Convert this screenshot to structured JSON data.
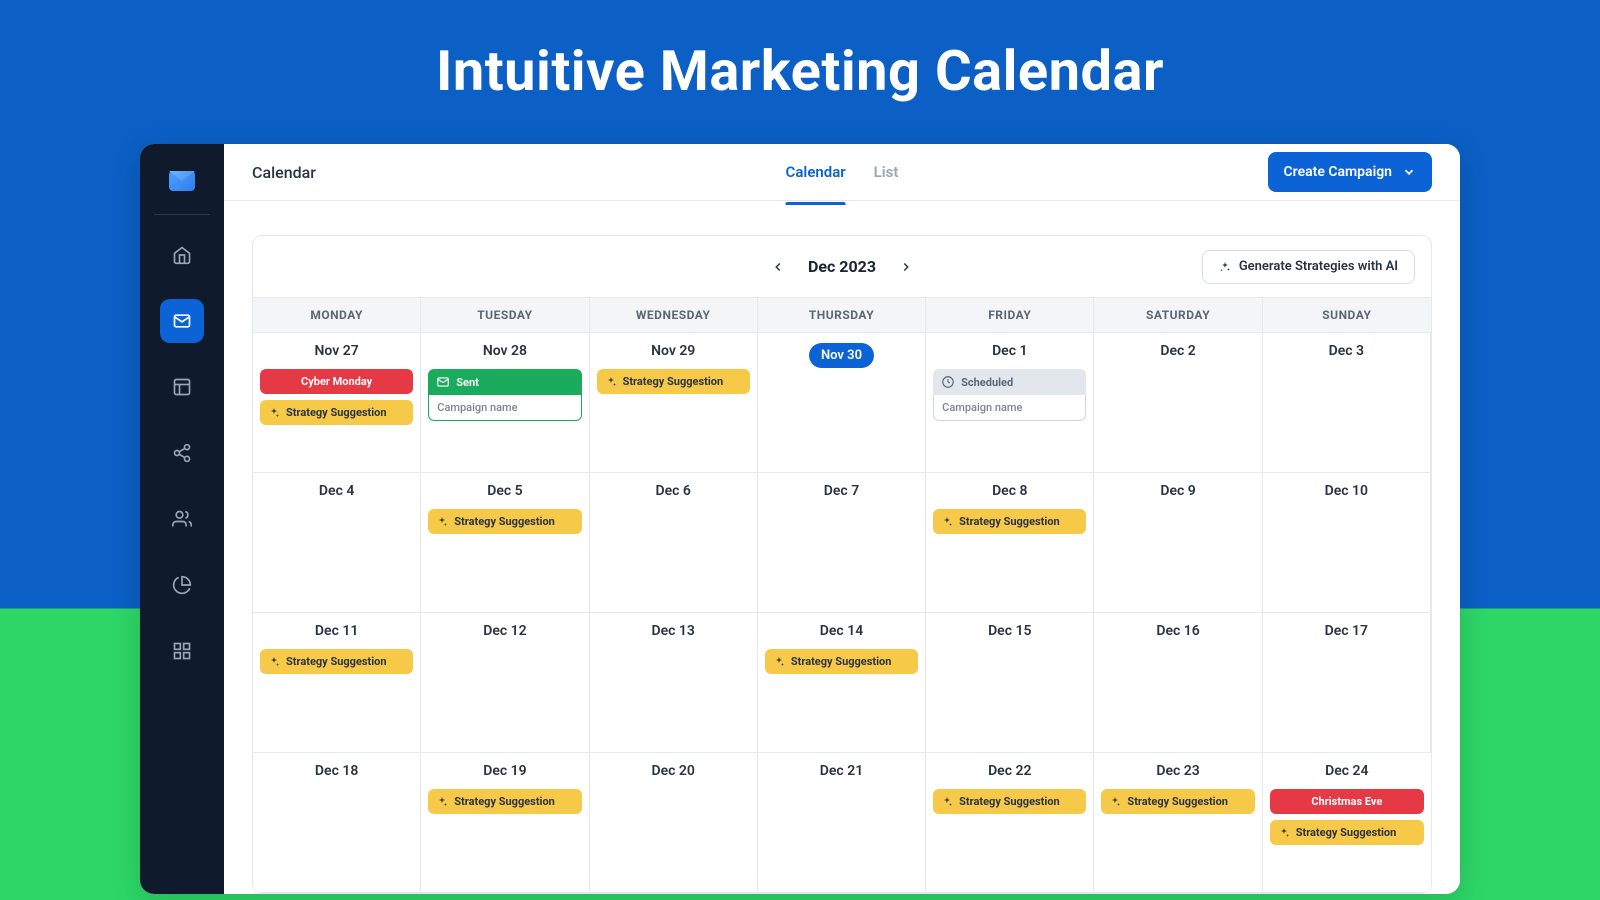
{
  "hero_title": "Intuitive Marketing Calendar",
  "breadcrumb": "Calendar",
  "tabs": {
    "calendar": "Calendar",
    "list": "List"
  },
  "create_btn": "Create Campaign",
  "month_label": "Dec 2023",
  "generate_btn": "Generate Strategies with AI",
  "dow": [
    "MONDAY",
    "TUESDAY",
    "WEDNESDAY",
    "THURSDAY",
    "FRIDAY",
    "SATURDAY",
    "SUNDAY"
  ],
  "labels": {
    "strategy": "Strategy Suggestion",
    "cyber_monday": "Cyber Monday",
    "christmas_eve": "Christmas Eve",
    "sent": "Sent",
    "scheduled": "Scheduled",
    "campaign_name": "Campaign name"
  },
  "weeks": [
    [
      {
        "date": "Nov 27",
        "chips": [
          {
            "t": "red",
            "k": "cyber_monday"
          },
          {
            "t": "yellow",
            "k": "strategy"
          }
        ]
      },
      {
        "date": "Nov 28",
        "chips": [
          {
            "t": "sent"
          }
        ]
      },
      {
        "date": "Nov 29",
        "chips": [
          {
            "t": "yellow",
            "k": "strategy"
          }
        ]
      },
      {
        "date": "Nov 30",
        "today": true,
        "chips": []
      },
      {
        "date": "Dec 1",
        "chips": [
          {
            "t": "scheduled"
          }
        ]
      },
      {
        "date": "Dec 2",
        "chips": []
      },
      {
        "date": "Dec 3",
        "chips": []
      }
    ],
    [
      {
        "date": "Dec 4",
        "chips": []
      },
      {
        "date": "Dec 5",
        "chips": [
          {
            "t": "yellow",
            "k": "strategy"
          }
        ]
      },
      {
        "date": "Dec 6",
        "chips": []
      },
      {
        "date": "Dec 7",
        "chips": []
      },
      {
        "date": "Dec 8",
        "chips": [
          {
            "t": "yellow",
            "k": "strategy"
          }
        ]
      },
      {
        "date": "Dec 9",
        "chips": []
      },
      {
        "date": "Dec 10",
        "chips": []
      }
    ],
    [
      {
        "date": "Dec 11",
        "chips": [
          {
            "t": "yellow",
            "k": "strategy"
          }
        ]
      },
      {
        "date": "Dec 12",
        "chips": []
      },
      {
        "date": "Dec 13",
        "chips": []
      },
      {
        "date": "Dec 14",
        "chips": [
          {
            "t": "yellow",
            "k": "strategy"
          }
        ]
      },
      {
        "date": "Dec 15",
        "chips": []
      },
      {
        "date": "Dec 16",
        "chips": []
      },
      {
        "date": "Dec 17",
        "chips": []
      }
    ],
    [
      {
        "date": "Dec 18",
        "chips": []
      },
      {
        "date": "Dec 19",
        "chips": [
          {
            "t": "yellow",
            "k": "strategy"
          }
        ]
      },
      {
        "date": "Dec 20",
        "chips": []
      },
      {
        "date": "Dec 21",
        "chips": []
      },
      {
        "date": "Dec 22",
        "chips": [
          {
            "t": "yellow",
            "k": "strategy"
          }
        ]
      },
      {
        "date": "Dec 23",
        "chips": [
          {
            "t": "yellow",
            "k": "strategy"
          }
        ]
      },
      {
        "date": "Dec 24",
        "chips": [
          {
            "t": "red",
            "k": "christmas_eve"
          },
          {
            "t": "yellow",
            "k": "strategy"
          }
        ]
      }
    ]
  ]
}
